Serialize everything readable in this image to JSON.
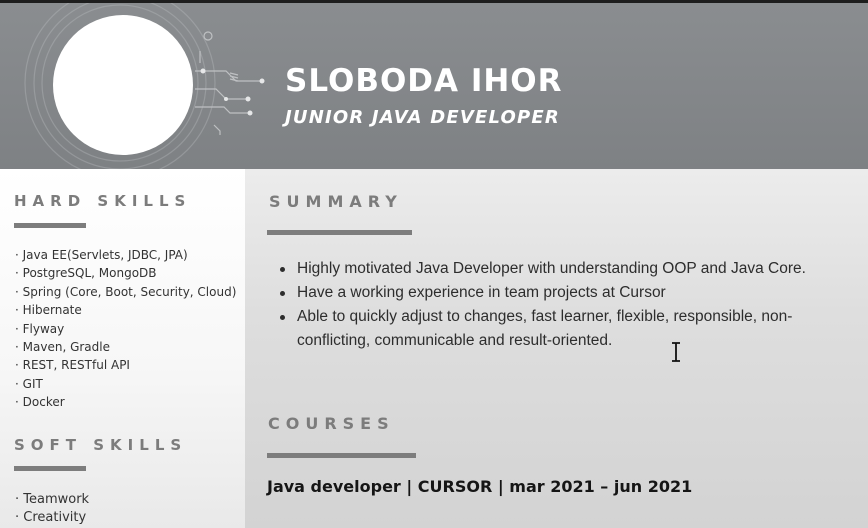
{
  "header": {
    "name": "SLOBODA IHOR",
    "role": "JUNIOR JAVA DEVELOPER"
  },
  "hard_skills": {
    "title": "HARD SKILLS",
    "items": [
      "Java EE(Servlets, JDBC, JPA)",
      "PostgreSQL, MongoDB",
      "Spring (Core, Boot, Security, Cloud)",
      "Hibernate",
      "Flyway",
      "Maven, Gradle",
      "REST, RESTful API",
      "GIT",
      "Docker"
    ]
  },
  "soft_skills": {
    "title": "SOFT SKILLS",
    "items": [
      "Teamwork",
      "Creativity"
    ]
  },
  "summary": {
    "title": "SUMMARY",
    "items": [
      "Highly motivated Java Developer with understanding OOP and Java Core.",
      "Have a working experience in team projects at Cursor",
      "Able to quickly adjust to changes, fast learner, flexible, responsible, non-conflicting, communicable and result-oriented."
    ]
  },
  "courses": {
    "title": "COURSES",
    "items": [
      "Java developer | CURSOR | mar 2021 – jun 2021"
    ]
  },
  "colors": {
    "header_bg": "#8a8d90",
    "accent_gray": "#7c7c7c"
  },
  "icons": [
    "text-cursor-icon",
    "circuit-decoration"
  ]
}
